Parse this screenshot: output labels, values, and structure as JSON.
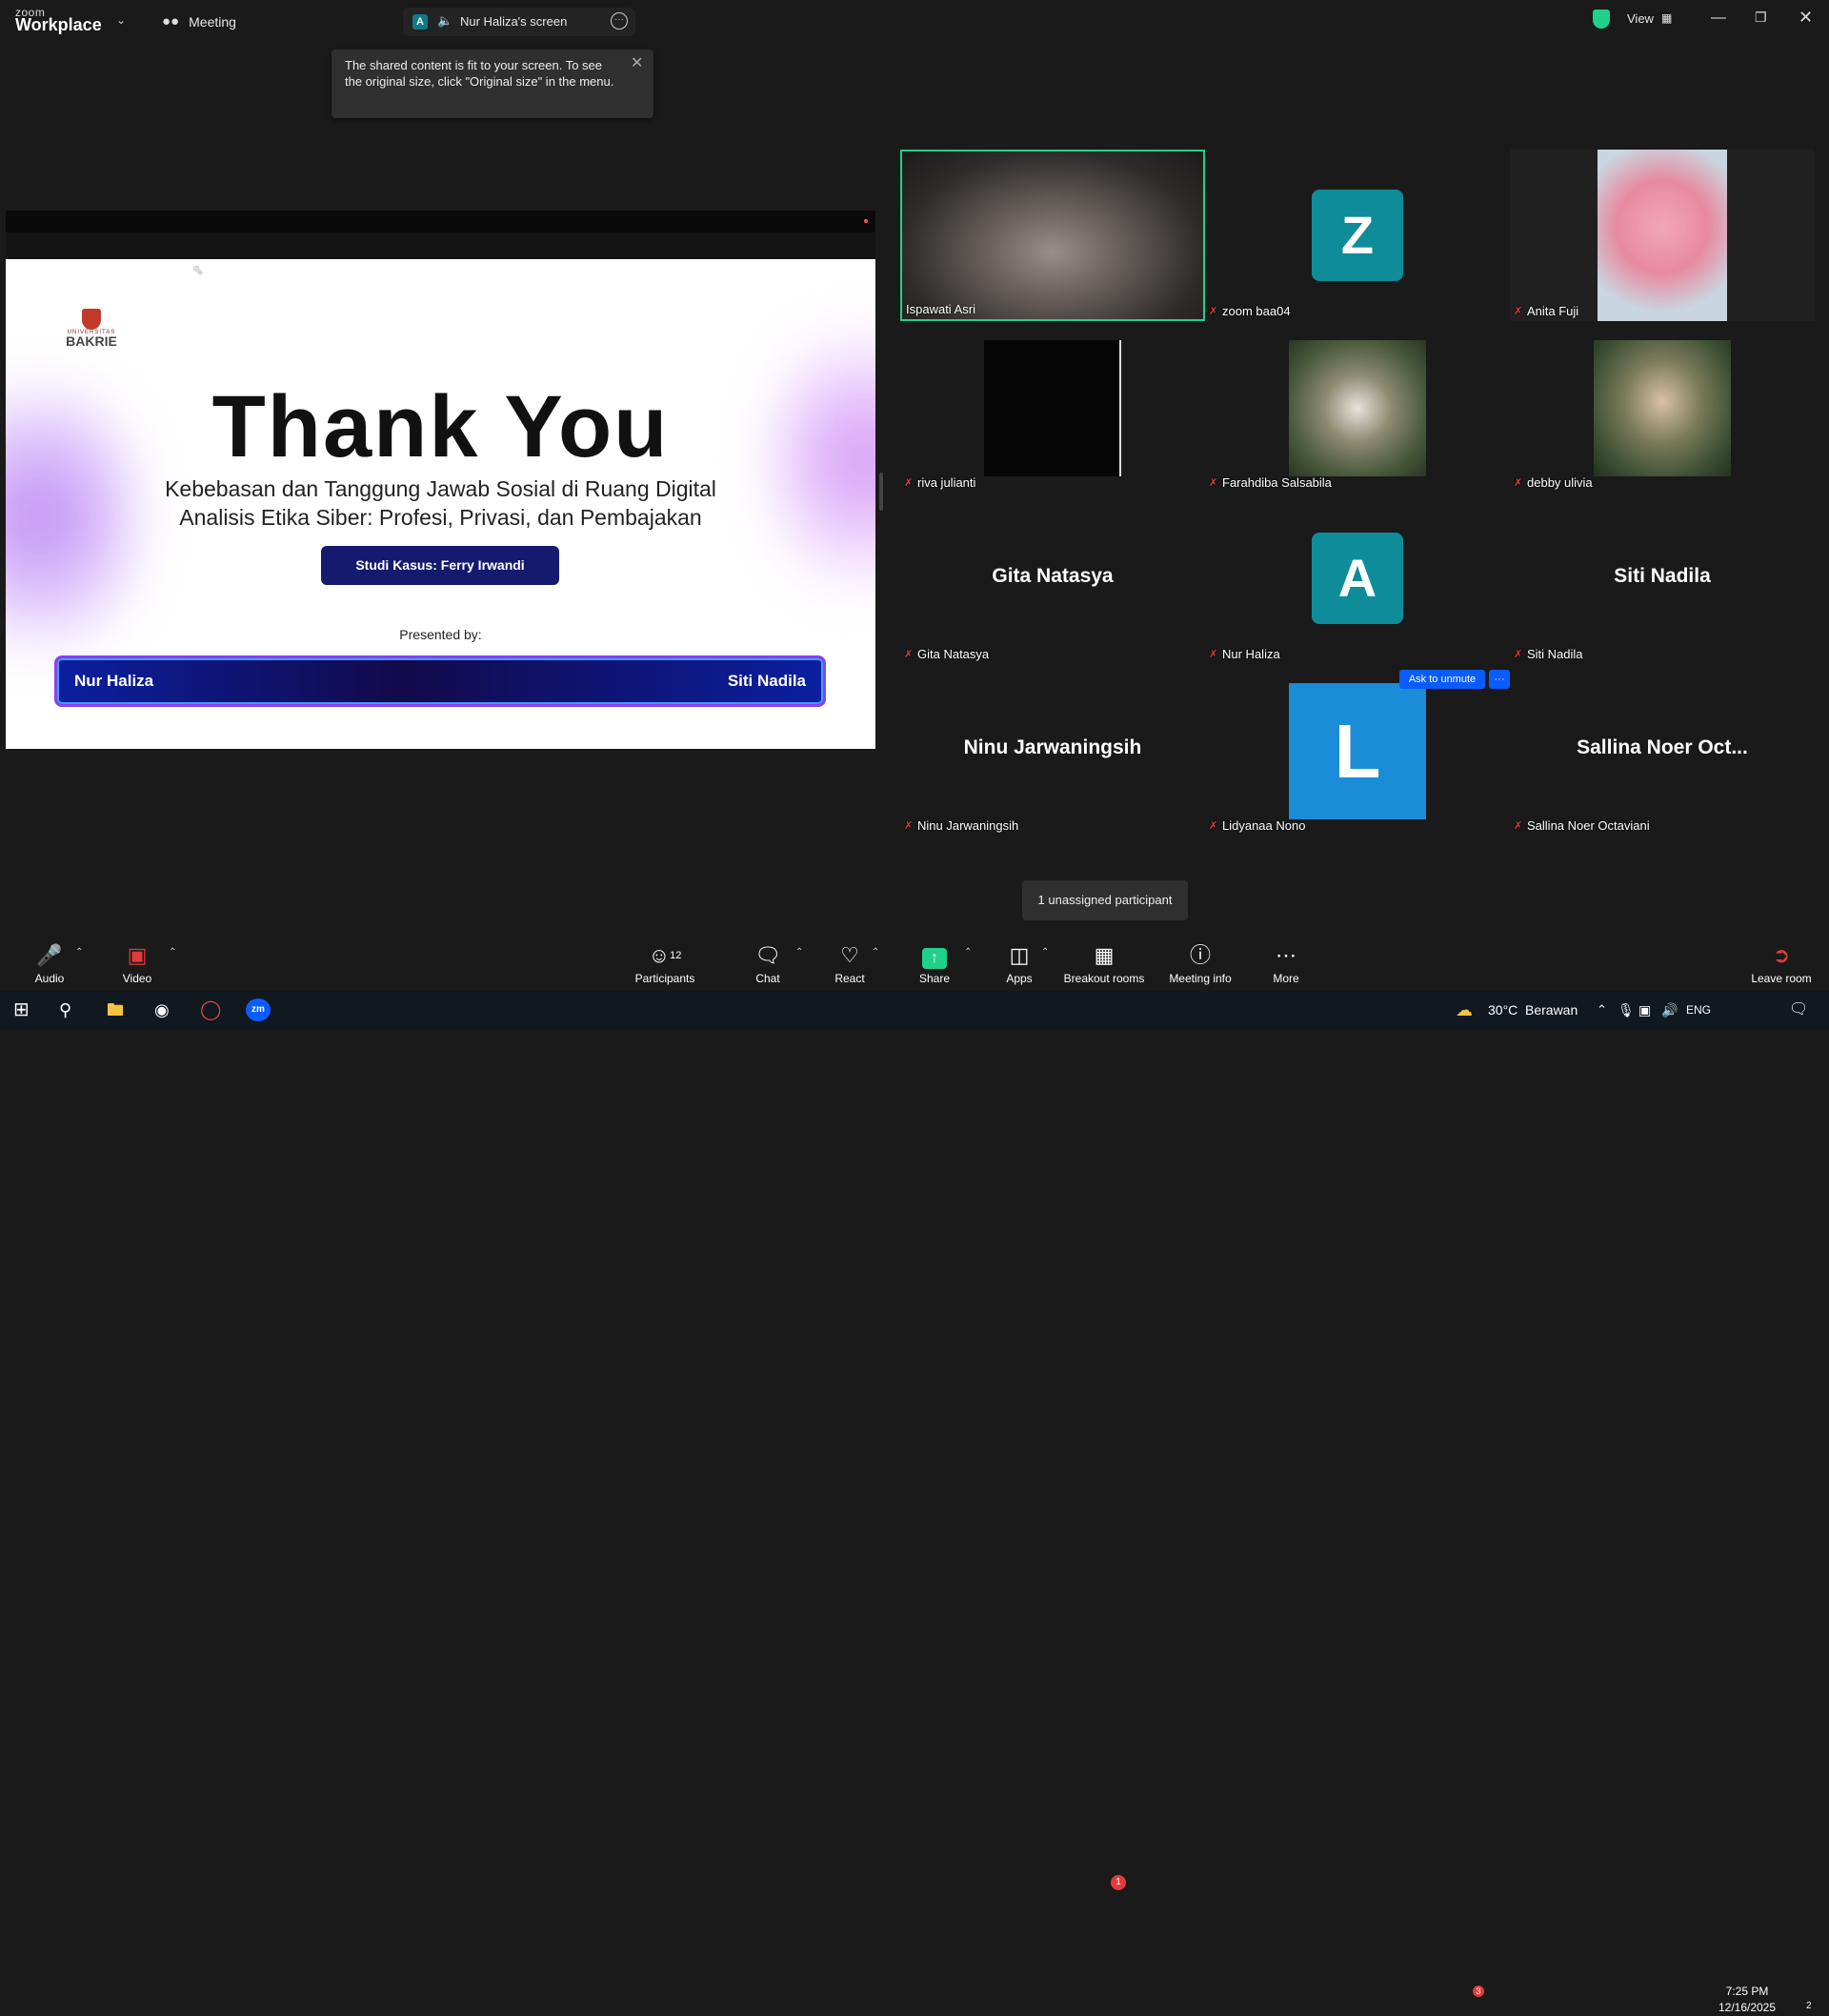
{
  "app": {
    "brand_small": "zoom",
    "brand_big": "Workplace",
    "meeting_label": "Meeting",
    "share_tab_label": "Nur Haliza's screen",
    "share_tab_avatar": "A",
    "view_label": "View"
  },
  "tooltip": {
    "text": "The shared content is fit to your screen. To see the original size, click \"Original size\" in the menu."
  },
  "slide": {
    "logo_sub": "UNIVERSITAS",
    "logo_main": "BAKRIE",
    "title": "Thank You",
    "subtitle_1": "Kebebasan dan Tanggung Jawab Sosial di Ruang Digital",
    "subtitle_2": "Analisis Etika Siber: Profesi, Privasi, dan Pembajakan",
    "case_button": "Studi Kasus: Ferry Irwandi",
    "presented_by": "Presented by:",
    "presenter_1": "Nur Haliza",
    "presenter_2": "Siti Nadila"
  },
  "gallery": {
    "tiles": [
      {
        "name": "Ispawati Asri",
        "muted": false
      },
      {
        "name": "zoom baa04",
        "muted": true,
        "avatar_letter": "Z"
      },
      {
        "name": "Anita Fuji",
        "muted": true
      },
      {
        "name": "riva julianti",
        "muted": true
      },
      {
        "name": "Farahdiba Salsabila",
        "muted": true
      },
      {
        "name": "debby ulivia",
        "muted": true
      },
      {
        "name": "Gita Natasya",
        "muted": true,
        "center_name": "Gita Natasya"
      },
      {
        "name": "Nur Haliza",
        "muted": true,
        "avatar_letter": "A"
      },
      {
        "name": "Siti Nadila",
        "muted": true,
        "center_name": "Siti Nadila"
      },
      {
        "name": "Ninu Jarwaningsih",
        "muted": true,
        "center_name": "Ninu Jarwaningsih"
      },
      {
        "name": "Lidyanaa Nono",
        "muted": true,
        "avatar_letter": "L"
      },
      {
        "name": "Sallina Noer Octaviani",
        "muted": true,
        "center_name": "Sallina Noer Oct..."
      }
    ],
    "ask_to_unmute": "Ask to unmute",
    "more_dots": "···",
    "unassigned_tooltip": "1 unassigned participant"
  },
  "toolbar": {
    "audio": "Audio",
    "video": "Video",
    "participants": "Participants",
    "participants_count": "12",
    "chat": "Chat",
    "react": "React",
    "share": "Share",
    "apps": "Apps",
    "breakout": "Breakout rooms",
    "breakout_badge": "1",
    "meeting_info": "Meeting info",
    "more": "More",
    "leave": "Leave room"
  },
  "taskbar": {
    "weather_temp": "30°C",
    "weather_desc": "Berawan",
    "weather_badge": "3",
    "lang": "ENG",
    "time": "7:25 PM",
    "date": "12/16/2025",
    "notif_count": "2"
  },
  "colors": {
    "accent_green": "#1fd18a",
    "zoom_blue": "#0b5cff",
    "avatar_teal": "#0e8c9a",
    "avatar_blue": "#1a8cd8",
    "mute_red": "#e23b3b"
  }
}
